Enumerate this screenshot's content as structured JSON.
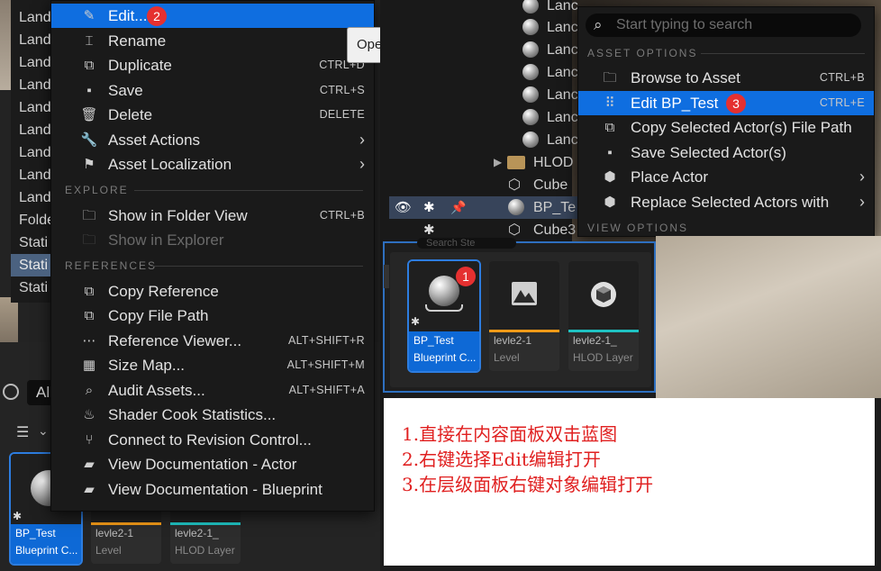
{
  "outliner_left": {
    "rows": [
      "Land",
      "Land",
      "Land",
      "Land",
      "Land",
      "Land",
      "Land",
      "Land",
      "Land",
      "Folde",
      "Stati",
      "Stati",
      "Stati"
    ],
    "selected_index": 11
  },
  "left_filter": {
    "label": "Al"
  },
  "left_context_menu": {
    "items": [
      {
        "label": "Edit...",
        "shortcut": "",
        "icon": "pencil-icon",
        "highlight": true,
        "badge": "2"
      },
      {
        "label": "Rename",
        "shortcut": "",
        "icon": "rename-icon"
      },
      {
        "label": "Duplicate",
        "shortcut": "CTRL+D",
        "icon": "duplicate-icon"
      },
      {
        "label": "Save",
        "shortcut": "CTRL+S",
        "icon": "save-icon"
      },
      {
        "label": "Delete",
        "shortcut": "DELETE",
        "icon": "trash-icon"
      },
      {
        "label": "Asset Actions",
        "shortcut": "",
        "icon": "wrench-icon",
        "submenu": true
      },
      {
        "label": "Asset Localization",
        "shortcut": "",
        "icon": "flag-icon",
        "submenu": true
      }
    ],
    "section_explore": "EXPLORE",
    "explore_items": [
      {
        "label": "Show in Folder View",
        "shortcut": "CTRL+B",
        "icon": "folder-search-icon"
      },
      {
        "label": "Show in Explorer",
        "shortcut": "",
        "icon": "folder-search-icon",
        "disabled": true
      }
    ],
    "section_references": "REFERENCES",
    "reference_items": [
      {
        "label": "Copy Reference",
        "shortcut": "",
        "icon": "copy-icon"
      },
      {
        "label": "Copy File Path",
        "shortcut": "",
        "icon": "copy-icon"
      },
      {
        "label": "Reference Viewer...",
        "shortcut": "ALT+SHIFT+R",
        "icon": "reference-viewer-icon"
      },
      {
        "label": "Size Map...",
        "shortcut": "ALT+SHIFT+M",
        "icon": "size-map-icon"
      },
      {
        "label": "Audit Assets...",
        "shortcut": "ALT+SHIFT+A",
        "icon": "audit-icon"
      },
      {
        "label": "Shader Cook Statistics...",
        "shortcut": "",
        "icon": "shader-icon"
      },
      {
        "label": "Connect to Revision Control...",
        "shortcut": "",
        "icon": "revision-control-icon"
      },
      {
        "label": "View Documentation - Actor",
        "shortcut": "",
        "icon": "documentation-icon"
      },
      {
        "label": "View Documentation - Blueprint",
        "shortcut": "",
        "icon": "documentation-icon"
      }
    ]
  },
  "tooltip": {
    "text": "Ope"
  },
  "left_assets": [
    {
      "name": "BP_Test",
      "type": "Blueprint C...",
      "bar_color": "#0e69d6"
    },
    {
      "name": "levle2-1",
      "type": "Level",
      "bar_color": "#f29a18"
    },
    {
      "name": "levle2-1_",
      "type": "HLOD Layer",
      "bar_color": "#1fc2c2"
    }
  ],
  "outliner_right": {
    "rows": [
      {
        "label": "Lanc",
        "kind": "actor"
      },
      {
        "label": "Lanc",
        "kind": "actor"
      },
      {
        "label": "Lanc",
        "kind": "actor"
      },
      {
        "label": "Lanc",
        "kind": "actor"
      },
      {
        "label": "Lanc",
        "kind": "actor"
      },
      {
        "label": "Lanc",
        "kind": "actor"
      },
      {
        "label": "Lanc",
        "kind": "actor"
      },
      {
        "label": "HLOD",
        "kind": "folder"
      },
      {
        "label": "Cube",
        "kind": "cube"
      },
      {
        "label": "BP_Te",
        "kind": "actor",
        "selected": true
      },
      {
        "label": "Cube3",
        "kind": "cube"
      }
    ]
  },
  "right_context_menu": {
    "search_placeholder": "Start typing to search",
    "section_asset": "ASSET OPTIONS",
    "items": [
      {
        "label": "Browse to Asset",
        "shortcut": "CTRL+B",
        "icon": "browse-asset-icon"
      },
      {
        "label": "Edit BP_Test",
        "shortcut": "CTRL+E",
        "icon": "blueprint-icon",
        "highlight": true,
        "badge": "3"
      },
      {
        "label": "Copy Selected Actor(s) File Path",
        "shortcut": "",
        "icon": "copy-icon"
      },
      {
        "label": "Save Selected Actor(s)",
        "shortcut": "",
        "icon": "save-icon"
      },
      {
        "label": "Place Actor",
        "shortcut": "",
        "icon": "place-actor-icon",
        "submenu": true
      },
      {
        "label": "Replace Selected Actors with",
        "shortcut": "",
        "icon": "replace-actor-icon",
        "submenu": true
      }
    ],
    "section_view": "VIEW OPTIONS"
  },
  "content_browser_mid": {
    "search_placeholder": "Search Ste",
    "assets": [
      {
        "name": "BP_Test",
        "type": "Blueprint C...",
        "bar_color": "#0e69d6",
        "badge": "1"
      },
      {
        "name": "levle2-1",
        "type": "Level",
        "bar_color": "#f29a18"
      },
      {
        "name": "levle2-1_",
        "type": "HLOD Layer",
        "bar_color": "#1fc2c2"
      }
    ]
  },
  "instructions": [
    "1.直接在内容面板双击蓝图",
    "2.右键选择Edit编辑打开",
    "3.在层级面板右键对象编辑打开"
  ],
  "colors": {
    "highlight": "#0f6ee0",
    "badge": "#e53030",
    "note_text": "#e02020"
  }
}
